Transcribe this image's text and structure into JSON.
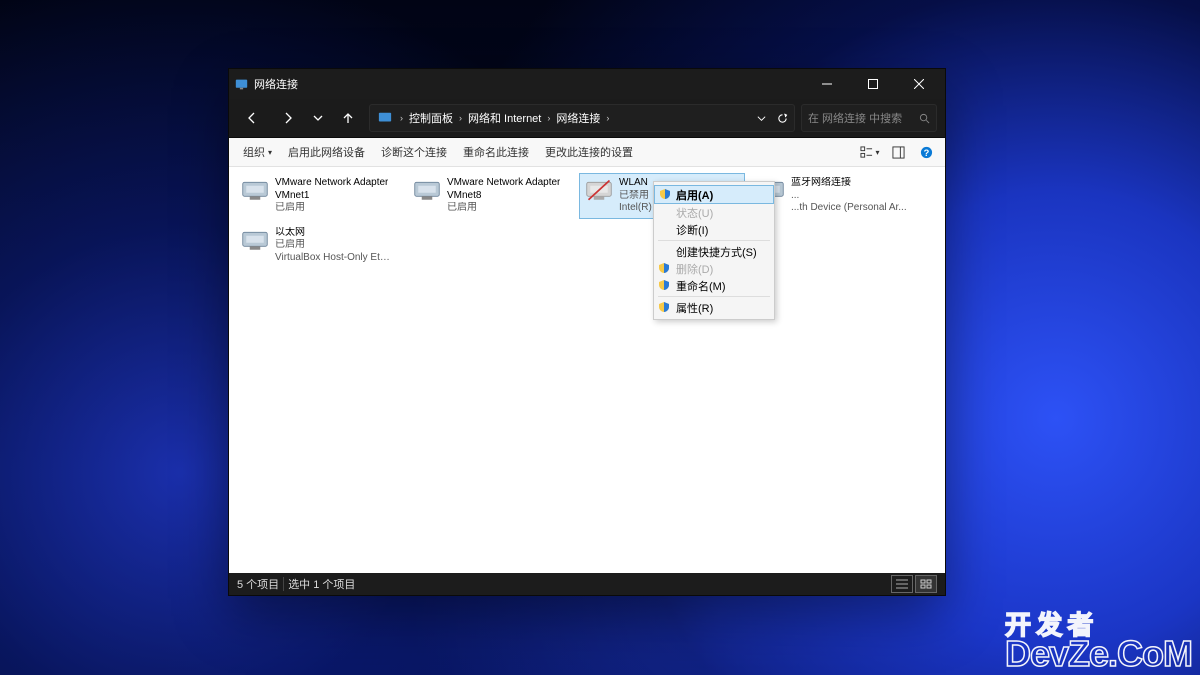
{
  "window": {
    "title": "网络连接"
  },
  "breadcrumb": {
    "p0": "控制面板",
    "p1": "网络和 Internet",
    "p2": "网络连接"
  },
  "search": {
    "placeholder": "在 网络连接 中搜索"
  },
  "toolbar": {
    "organize": "组织",
    "enable": "启用此网络设备",
    "diagnose": "诊断这个连接",
    "rename": "重命名此连接",
    "change": "更改此连接的设置"
  },
  "adapters": [
    {
      "l1": "VMware Network Adapter",
      "l2": "VMnet1",
      "l3": "已启用"
    },
    {
      "l1": "VMware Network Adapter",
      "l2": "VMnet8",
      "l3": "已启用"
    },
    {
      "l1": "WLAN",
      "l2": "已禁用",
      "l3": "Intel(R) Wireless-..."
    },
    {
      "l1": "蓝牙网络连接",
      "l2": "...",
      "l3": "...th Device (Personal Ar..."
    },
    {
      "l1": "以太网",
      "l2": "已启用",
      "l3": "VirtualBox Host-Only Ethernet ..."
    }
  ],
  "menu": {
    "enable": "启用(A)",
    "status": "状态(U)",
    "diagnose": "诊断(I)",
    "shortcut": "创建快捷方式(S)",
    "delete": "删除(D)",
    "rename": "重命名(M)",
    "properties": "属性(R)"
  },
  "status": {
    "count": "5 个项目",
    "selection": "选中 1 个项目"
  },
  "watermark": {
    "top": "开 发 者",
    "bottom": "DevZe.CoM"
  }
}
